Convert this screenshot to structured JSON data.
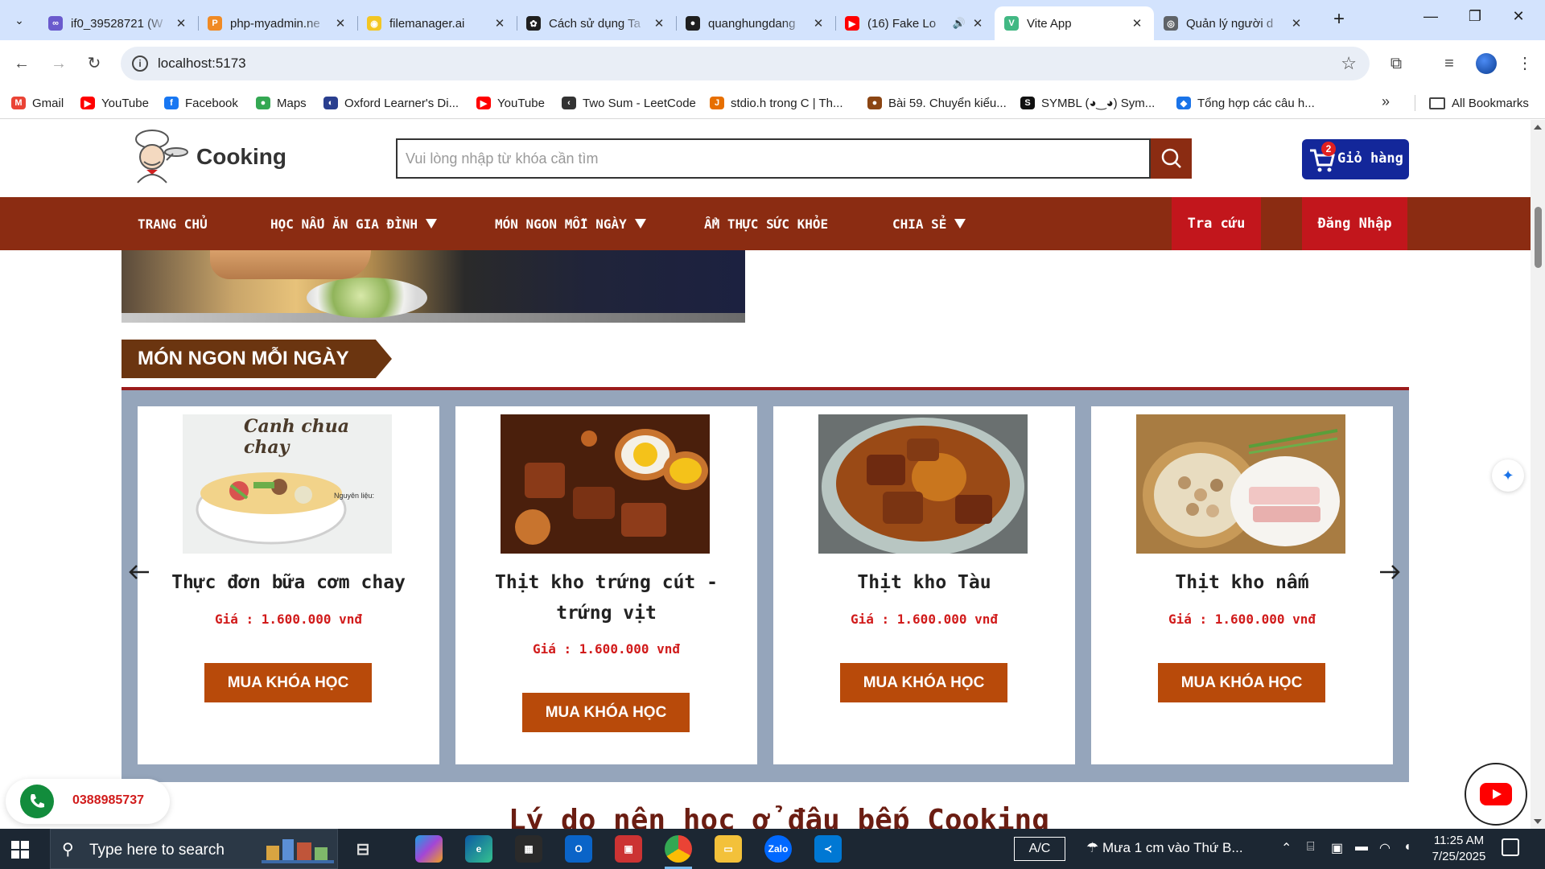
{
  "browser": {
    "tabs": [
      {
        "title": "if0_39528721 (W",
        "favicon_color": "#6a5acd",
        "favicon_glyph": "∞",
        "audio": false
      },
      {
        "title": "php-myadmin.ne",
        "favicon_color": "#f08a24",
        "favicon_glyph": "P",
        "audio": false
      },
      {
        "title": "filemanager.ai",
        "favicon_color": "#f3c623",
        "favicon_glyph": "◉",
        "audio": false
      },
      {
        "title": "Cách sử dụng Ta",
        "favicon_color": "#1f1f1f",
        "favicon_glyph": "✿",
        "audio": false
      },
      {
        "title": "quanghungdang",
        "favicon_color": "#1f1f1f",
        "favicon_glyph": "●",
        "audio": false
      },
      {
        "title": "(16) Fake Lo",
        "favicon_color": "#ff0000",
        "favicon_glyph": "▶",
        "audio": true
      },
      {
        "title": "Vite App",
        "favicon_color": "#41b883",
        "favicon_glyph": "V",
        "audio": false
      },
      {
        "title": "Quản lý người d",
        "favicon_color": "#5f6368",
        "favicon_glyph": "◎",
        "audio": false
      }
    ],
    "active_tab_index": 6,
    "url": "localhost:5173",
    "bookmarks": [
      {
        "label": "Gmail",
        "icon": "gmail-icon",
        "color": "#ea4335",
        "glyph": "M"
      },
      {
        "label": "YouTube",
        "icon": "youtube-icon",
        "color": "#ff0000",
        "glyph": "▶"
      },
      {
        "label": "Facebook",
        "icon": "facebook-icon",
        "color": "#1877f2",
        "glyph": "f"
      },
      {
        "label": "Maps",
        "icon": "maps-icon",
        "color": "#34a853",
        "glyph": "●"
      },
      {
        "label": "Oxford Learner's Di...",
        "icon": "oxford-icon",
        "color": "#2a3f8f",
        "glyph": "◐"
      },
      {
        "label": "YouTube",
        "icon": "youtube-icon",
        "color": "#ff0000",
        "glyph": "▶"
      },
      {
        "label": "Two Sum - LeetCode",
        "icon": "leetcode-icon",
        "color": "#333333",
        "glyph": "‹"
      },
      {
        "label": "stdio.h trong C | Th...",
        "icon": "java-icon",
        "color": "#e76f00",
        "glyph": "J"
      },
      {
        "label": "Bài 59. Chuyển kiểu...",
        "icon": "person-icon",
        "color": "#8b4513",
        "glyph": "●"
      },
      {
        "label": "SYMBL (◕‿◕) Sym...",
        "icon": "symbl-icon",
        "color": "#111111",
        "glyph": "S"
      },
      {
        "label": "Tổng hợp các câu h...",
        "icon": "diamond-icon",
        "color": "#1a73e8",
        "glyph": "◆"
      }
    ],
    "all_bookmarks_label": "All Bookmarks"
  },
  "site": {
    "logo_text": "Cooking",
    "search_placeholder": "Vui lòng nhập từ khóa cần tìm",
    "cart_label": "Giỏ hàng",
    "cart_count": "2",
    "nav": [
      {
        "label": "TRANG CHỦ",
        "dropdown": false
      },
      {
        "label": "HỌC NẤU ĂN GIA ĐÌNH",
        "dropdown": true
      },
      {
        "label": "MÓN NGON MỖI NGÀY",
        "dropdown": true
      },
      {
        "label": "ẨM THỰC SỨC KHỎE",
        "dropdown": false
      },
      {
        "label": "CHIA SẺ",
        "dropdown": true
      }
    ],
    "lookup_label": "Tra cứu",
    "login_label": "Đăng Nhập",
    "section_title": "MÓN NGON MỖI NGÀY",
    "cards": [
      {
        "title": "Thực đơn bữa cơm chay",
        "price": "Giá : 1.600.000 vnđ",
        "button": "MUA KHÓA HỌC",
        "image_caption": "Canh chua chay",
        "image_note": "Nguyên liệu:"
      },
      {
        "title": "Thịt kho trứng cút - trứng vịt",
        "price": "Giá : 1.600.000 vnđ",
        "button": "MUA KHÓA HỌC"
      },
      {
        "title": "Thịt kho Tàu",
        "price": "Giá : 1.600.000 vnđ",
        "button": "MUA KHÓA HỌC"
      },
      {
        "title": "Thịt kho nấm",
        "price": "Giá : 1.600.000 vnđ",
        "button": "MUA KHÓA HỌC"
      }
    ],
    "reasons_title": "Lý do nên học ở đâu bếp Cooking",
    "phone": "0388985737"
  },
  "taskbar": {
    "search_placeholder": "Type here to search",
    "ac_label": "A/C",
    "weather": "Mưa 1 cm vào Thứ B...",
    "time": "11:25 AM",
    "date": "7/25/2025"
  },
  "colors": {
    "brand_brown": "#8b2c12",
    "nav_red": "#c2161c",
    "cart_blue": "#13279a",
    "button_orange": "#b84a0a",
    "price_red": "#d11b1b",
    "carousel_bg": "#95a5bb"
  }
}
